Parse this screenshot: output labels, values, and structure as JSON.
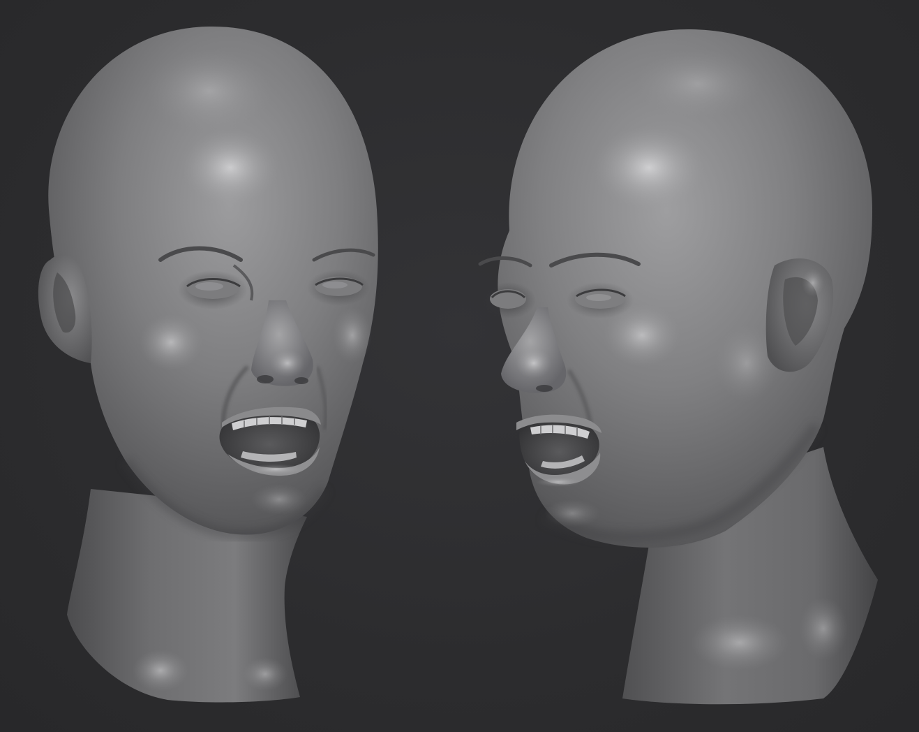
{
  "scene": {
    "background_color": "#2d2d2f",
    "clay_color": "#7a7a7c",
    "highlight_color": "#d0d0d2",
    "shadow_color": "#2a2a2c",
    "subjects": [
      {
        "name": "head-sculpt-three-quarter-left",
        "expression": "snarl",
        "view": "three-quarter"
      },
      {
        "name": "head-sculpt-three-quarter-right",
        "expression": "snarl",
        "view": "three-quarter-profile"
      }
    ]
  }
}
